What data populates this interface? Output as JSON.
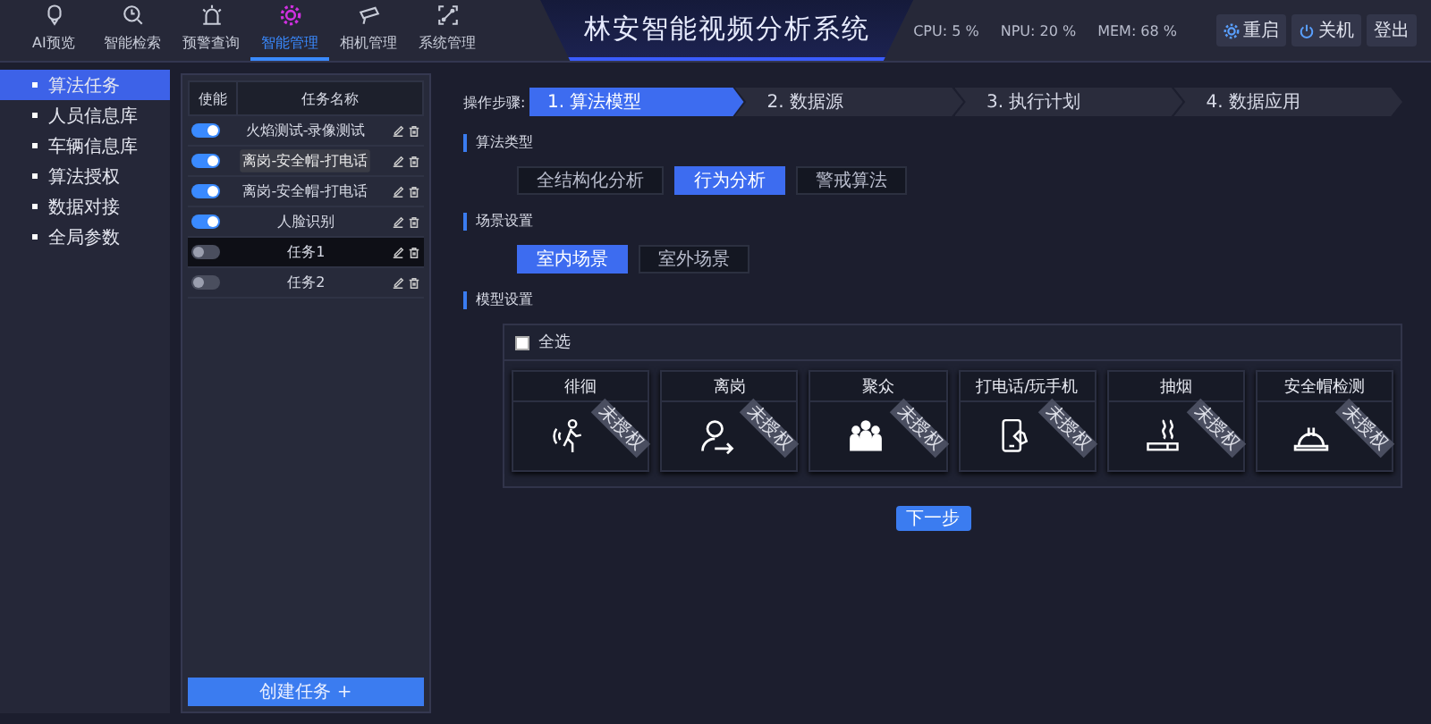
{
  "nav_tabs": [
    {
      "label": "AI预览",
      "selected": false
    },
    {
      "label": "智能检索",
      "selected": false
    },
    {
      "label": "预警查询",
      "selected": false
    },
    {
      "label": "智能管理",
      "selected": true
    },
    {
      "label": "相机管理",
      "selected": false
    },
    {
      "label": "系统管理",
      "selected": false
    }
  ],
  "title": "林安智能视频分析系统",
  "stats": [
    "CPU: 5 %",
    "NPU: 20 %",
    "MEM: 68 %"
  ],
  "header_buttons": [
    {
      "label": "重启"
    },
    {
      "label": "关机"
    },
    {
      "label": "登出"
    }
  ],
  "sidebar": {
    "items": [
      {
        "label": "算法任务",
        "selected": true
      },
      {
        "label": "人员信息库",
        "selected": false
      },
      {
        "label": "车辆信息库",
        "selected": false
      },
      {
        "label": "算法授权",
        "selected": false
      },
      {
        "label": "数据对接",
        "selected": false
      },
      {
        "label": "全局参数",
        "selected": false
      }
    ]
  },
  "task_table": {
    "columns": [
      "使能",
      "任务名称"
    ],
    "rows": [
      {
        "name": "火焰测试-录像测试",
        "enabled": true,
        "selected": false
      },
      {
        "tooltip": "离岗-安全帽-打电话",
        "enabled": true,
        "selected": false
      },
      {
        "name": "离岗-安全帽-打电话",
        "enabled": true,
        "selected": false
      },
      {
        "name": "人脸识别",
        "enabled": true,
        "selected": false
      },
      {
        "name": "任务1",
        "enabled": false,
        "selected": true
      },
      {
        "name": "任务2",
        "enabled": false,
        "selected": false
      }
    ],
    "create_button": "创建任务 +"
  },
  "steps_label": "操作步骤:",
  "steps": [
    {
      "label": "1. 算法模型",
      "selected": true
    },
    {
      "label": "2. 数据源",
      "selected": false
    },
    {
      "label": "3. 执行计划",
      "selected": false
    },
    {
      "label": "4. 数据应用",
      "selected": false
    }
  ],
  "algorithm_type": {
    "title": "算法类型",
    "options": [
      {
        "label": "全结构化分析",
        "selected": false
      },
      {
        "label": "行为分析",
        "selected": true
      },
      {
        "label": "警戒算法",
        "selected": false
      }
    ]
  },
  "scene": {
    "title": "场景设置",
    "options": [
      {
        "label": "室内场景",
        "selected": true
      },
      {
        "label": "室外场景",
        "selected": false
      }
    ]
  },
  "models": {
    "title": "模型设置",
    "select_all": {
      "label": "全选",
      "checked": false
    },
    "cards": [
      {
        "label": "徘徊",
        "ribbon": "未授权"
      },
      {
        "label": "离岗",
        "ribbon": "未授权"
      },
      {
        "label": "聚众",
        "ribbon": "未授权"
      },
      {
        "label": "打电话/玩手机",
        "ribbon": "未授权"
      },
      {
        "label": "抽烟",
        "ribbon": "未授权"
      },
      {
        "label": "安全帽检测",
        "ribbon": "未授权"
      }
    ]
  },
  "next_button": "下一步"
}
